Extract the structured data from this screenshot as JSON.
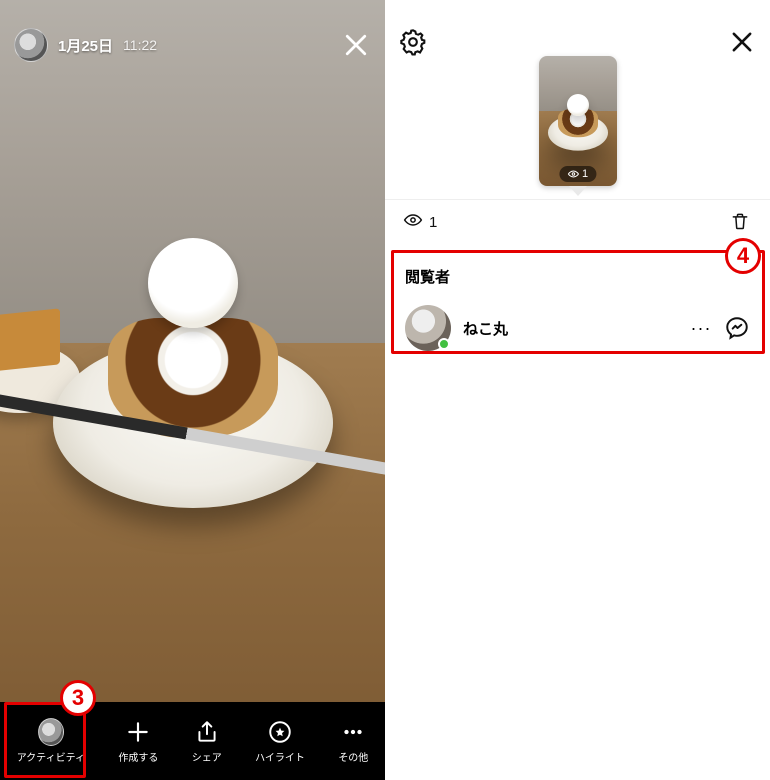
{
  "callouts": {
    "c3": "3",
    "c4": "4"
  },
  "left": {
    "date": "1月25日",
    "time": "11:22",
    "actions": {
      "activity": "アクティビティ",
      "create": "作成する",
      "share": "シェア",
      "highlight": "ハイライト",
      "more": "その他"
    }
  },
  "right": {
    "thumb_view_count": "1",
    "view_count": "1",
    "section_title": "閲覧者",
    "viewers": [
      {
        "name": "ねこ丸"
      }
    ]
  }
}
